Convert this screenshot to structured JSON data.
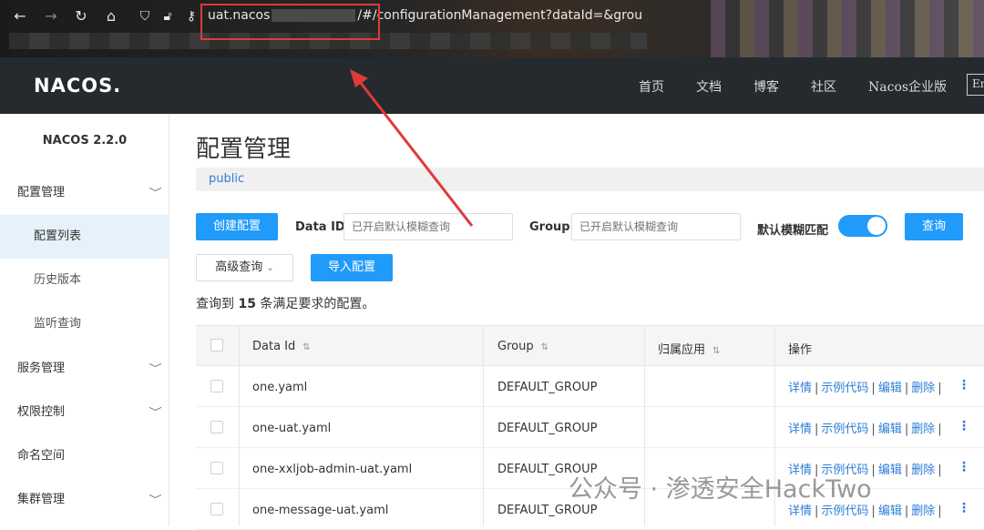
{
  "browser": {
    "url_prefix": "uat.nacos",
    "url_suffix": "/#/configurationManagement?dataId=&grou"
  },
  "header": {
    "logo": "NACOS.",
    "nav": [
      "首页",
      "文档",
      "博客",
      "社区",
      "Nacos企业版"
    ],
    "lang": "En"
  },
  "sidebar": {
    "version": "NACOS 2.2.0",
    "items": [
      {
        "label": "配置管理"
      },
      {
        "label": "配置列表"
      },
      {
        "label": "历史版本"
      },
      {
        "label": "监听查询"
      },
      {
        "label": "服务管理"
      },
      {
        "label": "权限控制"
      },
      {
        "label": "命名空间"
      },
      {
        "label": "集群管理"
      }
    ]
  },
  "main": {
    "title": "配置管理",
    "namespace": "public",
    "create_button": "创建配置",
    "dataid_label": "Data ID",
    "dataid_placeholder": "已开启默认模糊查询",
    "group_label": "Group",
    "group_placeholder": "已开启默认模糊查询",
    "fuzzy_label": "默认模糊匹配",
    "fuzzy_enabled": true,
    "query_button": "查询",
    "advanced_button": "高级查询",
    "import_button": "导入配置",
    "result_prefix": "查询到",
    "result_count": "15",
    "result_suffix": "条满足要求的配置。"
  },
  "table": {
    "headers": {
      "data_id": "Data Id",
      "group": "Group",
      "app": "归属应用",
      "ops": "操作"
    },
    "rows": [
      {
        "data_id": "one.yaml",
        "group": "DEFAULT_GROUP",
        "app": ""
      },
      {
        "data_id": "one-uat.yaml",
        "group": "DEFAULT_GROUP",
        "app": ""
      },
      {
        "data_id": "one-xxljob-admin-uat.yaml",
        "group": "DEFAULT_GROUP",
        "app": ""
      },
      {
        "data_id": "one-message-uat.yaml",
        "group": "DEFAULT_GROUP",
        "app": ""
      }
    ],
    "ops": {
      "detail": "详情",
      "sample": "示例代码",
      "edit": "编辑",
      "delete": "删除",
      "sep": "|"
    }
  },
  "watermark": "公众号 · 渗透安全HackTwo",
  "colors": {
    "primary": "#209bfa",
    "header_bg": "#252a2f",
    "link": "#2c7ed6",
    "annotation": "#e03a3a"
  }
}
